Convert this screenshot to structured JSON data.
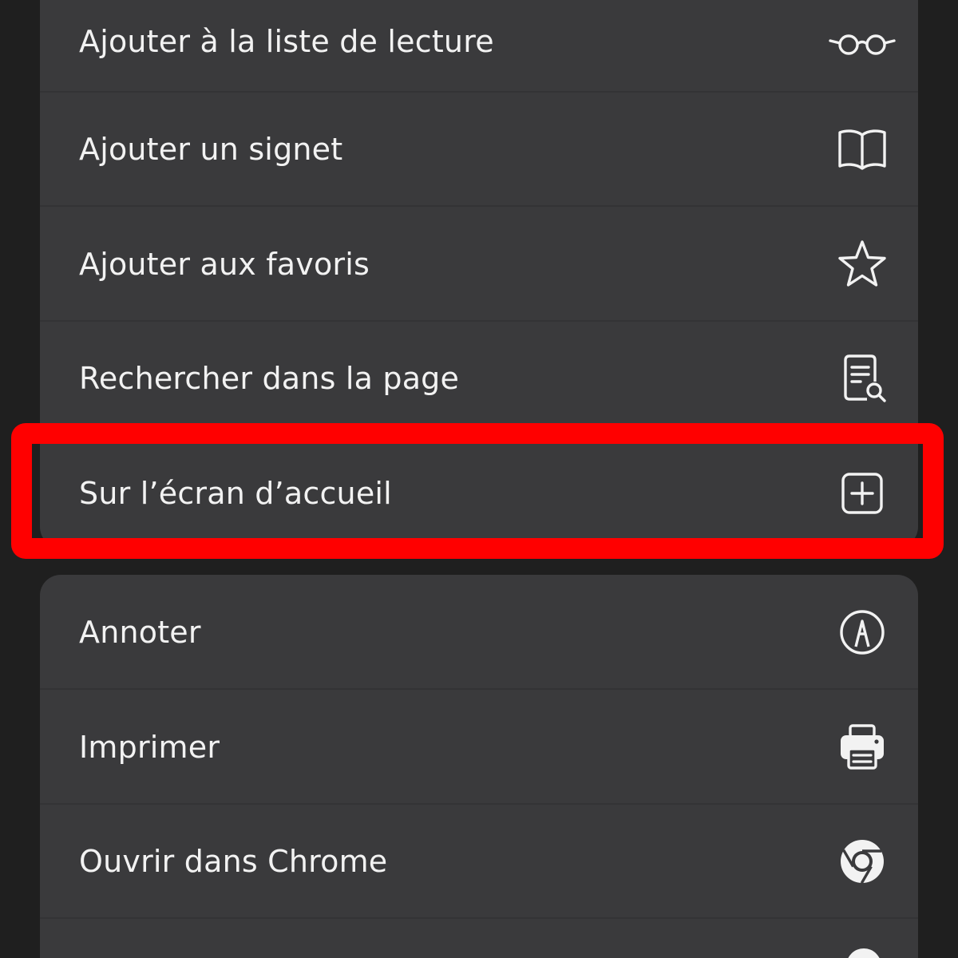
{
  "menu": {
    "group1": [
      {
        "label": "Ajouter à la liste de lecture",
        "icon": "glasses-icon"
      },
      {
        "label": "Ajouter un signet",
        "icon": "book-icon"
      },
      {
        "label": "Ajouter aux favoris",
        "icon": "star-icon"
      },
      {
        "label": "Rechercher dans la page",
        "icon": "document-search-icon"
      },
      {
        "label": "Sur l’écran d’accueil",
        "icon": "plus-square-icon"
      }
    ],
    "group2": [
      {
        "label": "Annoter",
        "icon": "markup-pen-icon"
      },
      {
        "label": "Imprimer",
        "icon": "printer-icon"
      },
      {
        "label": "Ouvrir dans Chrome",
        "icon": "chrome-icon"
      }
    ]
  },
  "colors": {
    "background": "#1f1f1f",
    "group": "#3a3a3c",
    "text": "#f2f2f2",
    "highlight": "#ff0000"
  }
}
